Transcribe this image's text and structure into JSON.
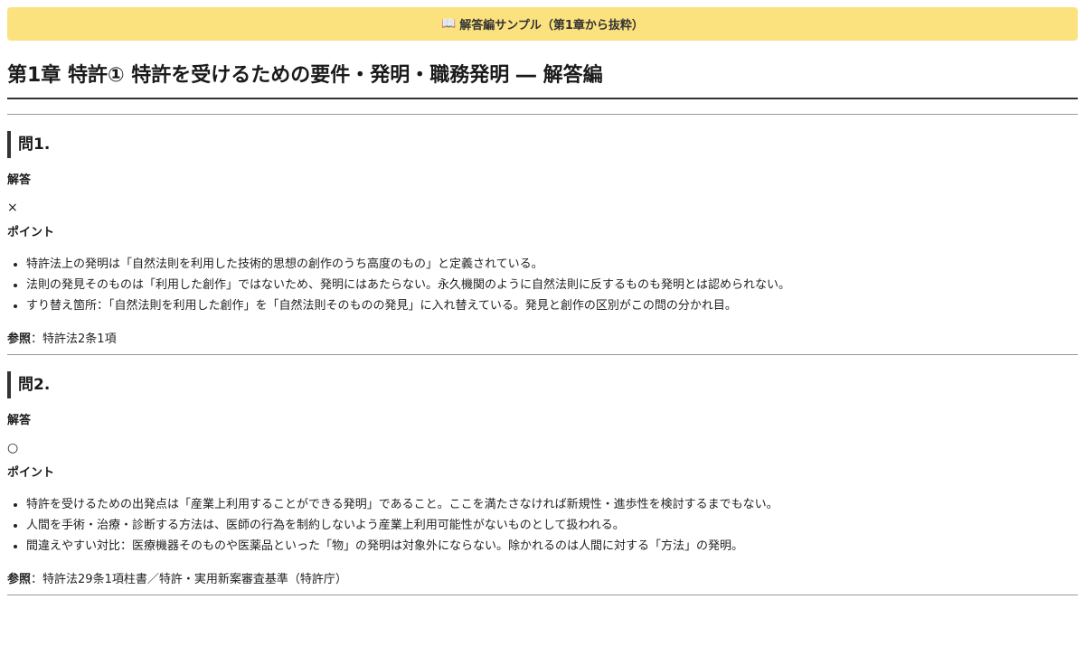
{
  "banner": {
    "icon": "📖",
    "text": "解答編サンプル（第1章から抜粋）"
  },
  "chapter": {
    "title": "第1章 特許① 特許を受けるための要件・発明・職務発明 ― 解答編"
  },
  "labels": {
    "answer": "解答",
    "points": "ポイント",
    "reference": "参照",
    "reference_sep": "："
  },
  "questions": [
    {
      "heading": "問1.",
      "answer": "×",
      "points": [
        "特許法上の発明は「自然法則を利用した技術的思想の創作のうち高度のもの」と定義されている。",
        "法則の発見そのものは「利用した創作」ではないため、発明にはあたらない。永久機関のように自然法則に反するものも発明とは認められない。",
        "すり替え箇所：「自然法則を利用した創作」を「自然法則そのものの発見」に入れ替えている。発見と創作の区別がこの問の分かれ目。"
      ],
      "reference": "特許法2条1項"
    },
    {
      "heading": "問2.",
      "answer": "○",
      "points": [
        "特許を受けるための出発点は「産業上利用することができる発明」であること。ここを満たさなければ新規性・進歩性を検討するまでもない。",
        "人間を手術・治療・診断する方法は、医師の行為を制約しないよう産業上利用可能性がないものとして扱われる。",
        "間違えやすい対比：医療機器そのものや医薬品といった「物」の発明は対象外にならない。除かれるのは人間に対する「方法」の発明。"
      ],
      "reference": "特許法29条1項柱書／特許・実用新案審査基準（特許庁）"
    }
  ]
}
